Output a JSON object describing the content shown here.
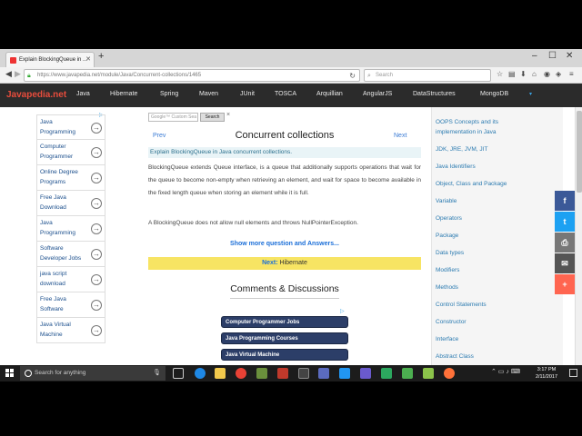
{
  "browser": {
    "tab_title": "Explain BlockingQueue in ...",
    "url": "https://www.javapedia.net/module/Java/Concurrent-collections/1465",
    "search_placeholder": "Search"
  },
  "site": {
    "logo": "Javapedia.net",
    "nav": [
      "Java",
      "Hibernate",
      "Spring",
      "Maven",
      "JUnit",
      "TOSCA",
      "Arquillian",
      "AngularJS",
      "DataStructures",
      "MongoDB"
    ]
  },
  "left_ads": [
    "Java Programming",
    "Computer Programmer",
    "Online Degree Programs",
    "Free Java Download",
    "Java Programming",
    "Software Developer Jobs",
    "java script download",
    "Free Java Software",
    "Java Virtual Machine"
  ],
  "google_search": {
    "placeholder": "Google™ Custom Sea",
    "button": "Search",
    "clear": "×"
  },
  "main": {
    "prev": "Prev",
    "next": "Next",
    "title": "Concurrent collections",
    "question": "Explain BlockingQueue in Java concurrent collections.",
    "answer": "BlockingQueue extends Queue interface, is a queue that additionally supports operations that wait for the queue to become non-empty when retrieving an element, and wait for space to become available in the fixed length queue when storing an element while it is full.",
    "answer2": "A BlockingQueue does not allow null elements and throws NullPointerException.",
    "show_more": "Show more question and Answers...",
    "next_label": "Next:",
    "next_target": "Hibernate",
    "comments_title": "Comments & Discussions",
    "mid_ads": [
      "Computer Programmer Jobs",
      "Java Programming Courses",
      "Java Virtual Machine"
    ]
  },
  "sidebar": [
    "OOPS Concepts and its",
    "implementation in Java",
    "JDK, JRE, JVM, JIT",
    "Java Identifiers",
    "Object, Class and Package",
    "Variable",
    "Operators",
    "Package",
    "Data types",
    "Modifiers",
    "Methods",
    "Control Statements",
    "Constructor",
    "Interface",
    "Abstract Class"
  ],
  "social": [
    "f",
    "t",
    "⎙",
    "✉",
    "+"
  ],
  "taskbar": {
    "search_text": "Search for anything",
    "time": "3:17 PM",
    "date": "2/11/2017"
  },
  "colors": {
    "site_nav_bg": "#2b2b2b",
    "logo": "#e74c3c",
    "next_bar": "#f7e463",
    "facebook": "#3b5998",
    "twitter": "#1da1f2",
    "print": "#777777",
    "email": "#555555",
    "plus": "#ff6550"
  }
}
